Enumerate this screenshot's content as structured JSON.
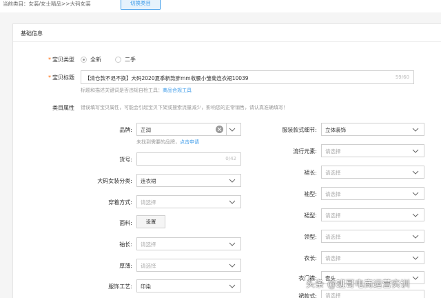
{
  "category": {
    "current_label": "当前类目：女装/女士精品>>大码女装",
    "switch_button": "切换类目"
  },
  "section": {
    "title": "基础信息"
  },
  "item_type": {
    "label": "宝贝类型",
    "options": [
      "全新",
      "二手"
    ],
    "selected": "全新"
  },
  "item_title": {
    "label": "宝贝标题",
    "value": "【清仓款不退不换】大码2020夏季新款胖mm收腰小雏菊连衣裙10039",
    "count": "59/60",
    "hint_text": "标题和描述关键词是否违规自检工具：",
    "hint_link": "商品合规工具"
  },
  "category_attrs": {
    "label": "类目属性",
    "warning": "错误填写宝贝属性，可能会引起宝贝下架或搜索流量减少，影响您的正常销售，请认真准确填写！"
  },
  "left_fields": {
    "brand": {
      "label": "品牌:",
      "value": "芷润",
      "hint_text": "未找到需要的品牌，",
      "hint_link": "点击申请"
    },
    "item_no": {
      "label": "货号:",
      "count": "0/42"
    },
    "plus_category": {
      "label": "大码女装分类:",
      "value": "连衣裙"
    },
    "wear_style": {
      "label": "穿着方式:",
      "placeholder": "请选择"
    },
    "fabric": {
      "label": "面料:",
      "button": "设置"
    },
    "sleeve_length": {
      "label": "袖长:",
      "placeholder": "请选择"
    },
    "thickness": {
      "label": "厚薄:",
      "placeholder": "请选择"
    },
    "decoration": {
      "label": "服饰工艺:",
      "value": "印染"
    }
  },
  "right_fields": {
    "style_detail": {
      "label": "服装款式细节:",
      "value": "立体装饰"
    },
    "trend": {
      "label": "流行元素:",
      "placeholder": "请选择"
    },
    "skirt_length": {
      "label": "裙长:",
      "placeholder": "请选择"
    },
    "sleeve_type": {
      "label": "袖型:",
      "placeholder": "请选择"
    },
    "skirt_type": {
      "label": "裙型:",
      "placeholder": "请选择"
    },
    "collar": {
      "label": "领型:",
      "placeholder": "请选择"
    },
    "length": {
      "label": "衣长:",
      "placeholder": "请选择"
    },
    "closure": {
      "label": "衣门襟:",
      "value": "套头"
    },
    "skirt_style": {
      "label": "裙款式:",
      "placeholder": "请选择"
    }
  },
  "watermark": "头条 @班哥电商运营实训",
  "colors": {
    "accent": "#3d9be9",
    "required": "#ff6600"
  }
}
